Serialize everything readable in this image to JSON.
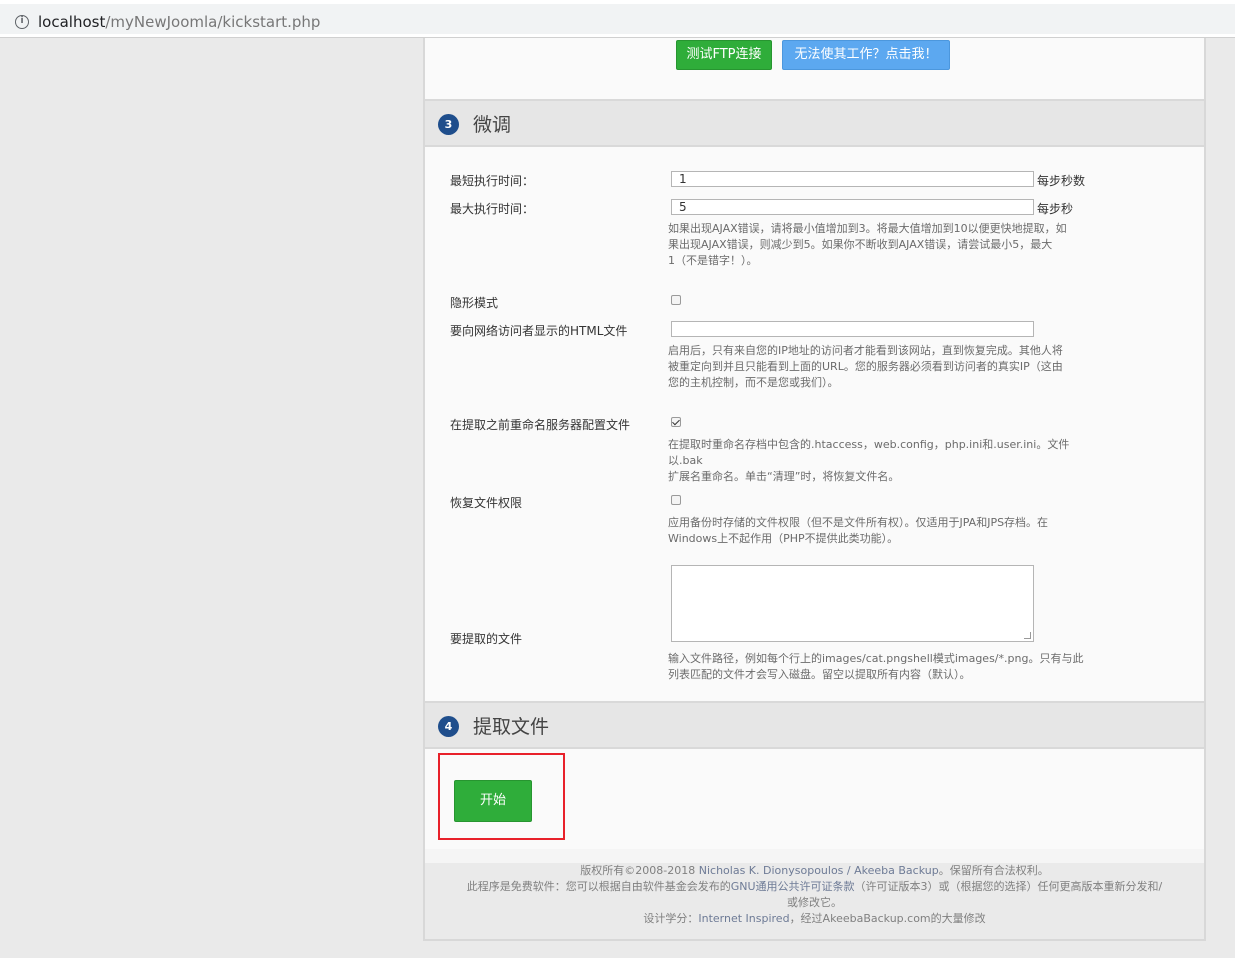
{
  "browser": {
    "url_host": "localhost",
    "url_path": "/myNewJoomla/kickstart.php"
  },
  "ftp": {
    "test_button": "测试FTP连接",
    "help_button": "无法使其工作？点击我！"
  },
  "section3": {
    "number": "3",
    "title": "微调",
    "min_exec_label": "最短执行时间：",
    "min_exec_value": "1",
    "min_exec_unit": "每步秒数",
    "max_exec_label": "最大执行时间：",
    "max_exec_value": "5",
    "max_exec_unit": "每步秒",
    "exec_help": [
      "如果出现AJAX错误，请将最小值增加到3。将最大值增加到10以便更快地提取，如",
      "果出现AJAX错误，则减少到5。如果你不断收到AJAX错误，请尝试最小5，最大",
      "1（不是错字！）。"
    ],
    "stealth_label": "隐形模式",
    "stealth_checked": false,
    "html_file_label": "要向网络访问者显示的HTML文件",
    "html_file_value": "",
    "stealth_help": [
      "启用后，只有来自您的IP地址的访问者才能看到该网站，直到恢复完成。其他人将",
      "被重定向到并且只能看到上面的URL。您的服务器必须看到访问者的真实IP（这由",
      "您的主机控制，而不是您或我们）。"
    ],
    "rename_label": "在提取之前重命名服务器配置文件",
    "rename_checked": true,
    "rename_help": [
      "在提取时重命名存档中包含的.htaccess，web.config，php.ini和.user.ini。文件以.bak",
      "扩展名重命名。单击“清理”时，将恢复文件名。"
    ],
    "restore_perms_label": "恢复文件权限",
    "restore_perms_checked": false,
    "restore_perms_help": [
      "应用备份时存储的文件权限（但不是文件所有权）。仅适用于JPA和JPS存档。在",
      "Windows上不起作用（PHP不提供此类功能）。"
    ],
    "extract_files_label": "要提取的文件",
    "extract_files_value": "",
    "extract_files_help": [
      "输入文件路径，例如每个行上的images/cat.pngshell模式images/*.png。只有与此",
      "列表匹配的文件才会写入磁盘。留空以提取所有内容（默认）。"
    ]
  },
  "section4": {
    "number": "4",
    "title": "提取文件",
    "start_button": "开始"
  },
  "footer": {
    "line1_prefix": "版权所有©2008-2018 ",
    "line1_link": "Nicholas K. Dionysopoulos / Akeeba Backup",
    "line1_suffix": "。保留所有合法权利。",
    "line2_prefix": "此程序是免费软件：您可以根据自由软件基金会发布的",
    "line2_link": "GNU通用公共许可证条款",
    "line2_suffix": "（许可证版本3）或（根据您的选择）任何更高版本重新分发和/",
    "line3": "或修改它。",
    "line4_prefix": "设计学分：",
    "line4_link": "Internet Inspired",
    "line4_suffix": "，经过AkeebaBackup.com的大量修改"
  },
  "colors": {
    "green_button": "#2fad3a",
    "blue_button": "#5ca8f0",
    "step_badge": "#1f4e8c",
    "highlight_border": "#e8212a"
  }
}
